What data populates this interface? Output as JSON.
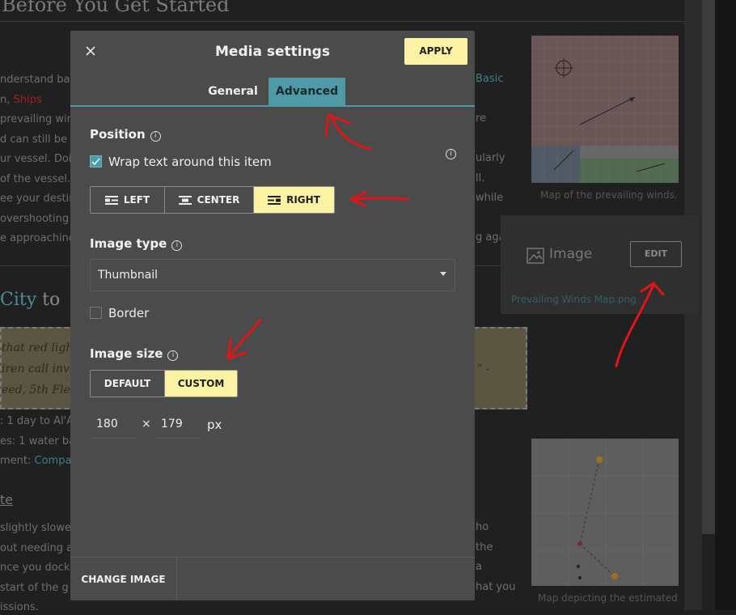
{
  "background": {
    "heading": "Before You Get Started",
    "lines": [
      "nderstand bas",
      "n, ",
      "prevailing win",
      "d can still be s",
      "ur vessel. Doi",
      " of the vessel.",
      "ee your destin",
      " overshooting",
      "e approaching"
    ],
    "ships_link": "Ships",
    "right_fragments": [
      "Basic",
      "re",
      "ularly",
      "ll.",
      "while",
      "g aga"
    ],
    "section_heading_link": "City",
    "section_heading_rest": " to",
    "quote_lines": [
      "that red ligh",
      "iren call inv",
      "eed, 5th Fle"
    ],
    "quote_tail": "\" -",
    "stat_lines": [
      ": 1 day to Al'Ar",
      "es: 1 water bar",
      "ment: "
    ],
    "compass_link": "Compas",
    "sub_heading": "te",
    "bottom_lines": [
      "slightly slowe",
      "out needing a",
      "nce you dock",
      " start of the g",
      "issions."
    ],
    "bottom_right": [
      "ho",
      "the",
      "a",
      "hat you"
    ],
    "caption1": "Map of the prevailing winds.",
    "caption2": "Map depicting the estimated"
  },
  "edit_popover": {
    "type_label": "Image",
    "edit_label": "EDIT",
    "file_name": "Prevailing Winds Map.png"
  },
  "modal": {
    "title": "Media settings",
    "apply_label": "APPLY",
    "tabs": [
      {
        "label": "General",
        "active": false
      },
      {
        "label": "Advanced",
        "active": true
      }
    ],
    "position": {
      "title": "Position",
      "wrap_label": "Wrap text around this item",
      "wrap_checked": true,
      "alignments": [
        {
          "label": "LEFT",
          "selected": false
        },
        {
          "label": "CENTER",
          "selected": false
        },
        {
          "label": "RIGHT",
          "selected": true
        }
      ]
    },
    "image_type": {
      "title": "Image type",
      "value": "Thumbnail",
      "border_label": "Border",
      "border_checked": false
    },
    "image_size": {
      "title": "Image size",
      "options": [
        {
          "label": "DEFAULT",
          "selected": false
        },
        {
          "label": "CUSTOM",
          "selected": true
        }
      ],
      "width": "180",
      "height": "179",
      "separator": "×",
      "unit": "px"
    },
    "change_image_label": "CHANGE IMAGE"
  },
  "colors": {
    "accent": "#4e9aa7",
    "highlight": "#fbf3a3",
    "annotation": "#e01515"
  }
}
